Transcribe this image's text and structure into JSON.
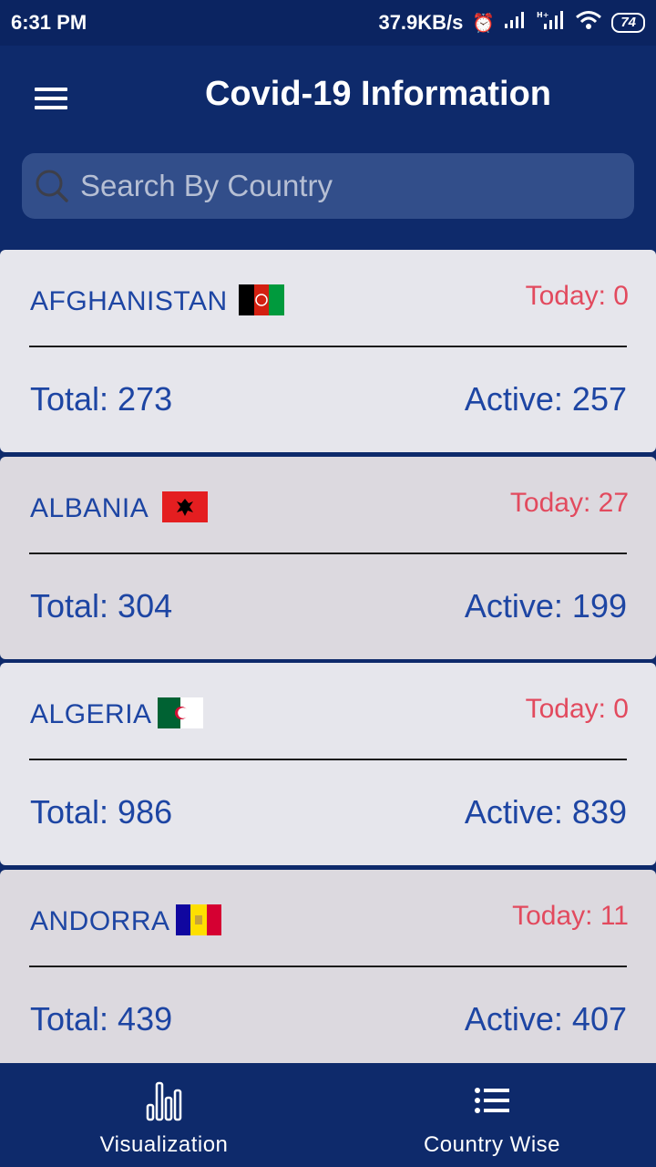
{
  "status_bar": {
    "time": "6:31 PM",
    "network_speed": "37.9KB/s",
    "battery": "74",
    "icons": [
      "alarm-icon",
      "signal-icon",
      "signal-h-plus-icon",
      "wifi-icon",
      "battery-icon"
    ]
  },
  "header": {
    "title": "Covid-19 Information",
    "menu_icon": "hamburger-menu-icon"
  },
  "search": {
    "placeholder": "Search By Country",
    "value": "",
    "icon": "search-icon"
  },
  "countries": [
    {
      "name": "AFGHANISTAN",
      "flag": "afghanistan-flag",
      "today": "Today: 0",
      "total": "Total: 273",
      "active": "Active: 257"
    },
    {
      "name": "ALBANIA",
      "flag": "albania-flag",
      "today": "Today: 27",
      "total": "Total: 304",
      "active": "Active: 199"
    },
    {
      "name": "ALGERIA",
      "flag": "algeria-flag",
      "today": "Today: 0",
      "total": "Total: 986",
      "active": "Active: 839"
    },
    {
      "name": "ANDORRA",
      "flag": "andorra-flag",
      "today": "Today: 11",
      "total": "Total: 439",
      "active": "Active: 407"
    }
  ],
  "bottom_nav": [
    {
      "label": "Visualization",
      "icon": "bar-chart-icon"
    },
    {
      "label": "Country Wise",
      "icon": "list-icon"
    }
  ],
  "colors": {
    "primary": "#0e2a6b",
    "country_text": "#1d45a3",
    "today_text": "#e24a5e",
    "card_light": "#e6e6ec",
    "card_dark": "#dcd9df"
  }
}
